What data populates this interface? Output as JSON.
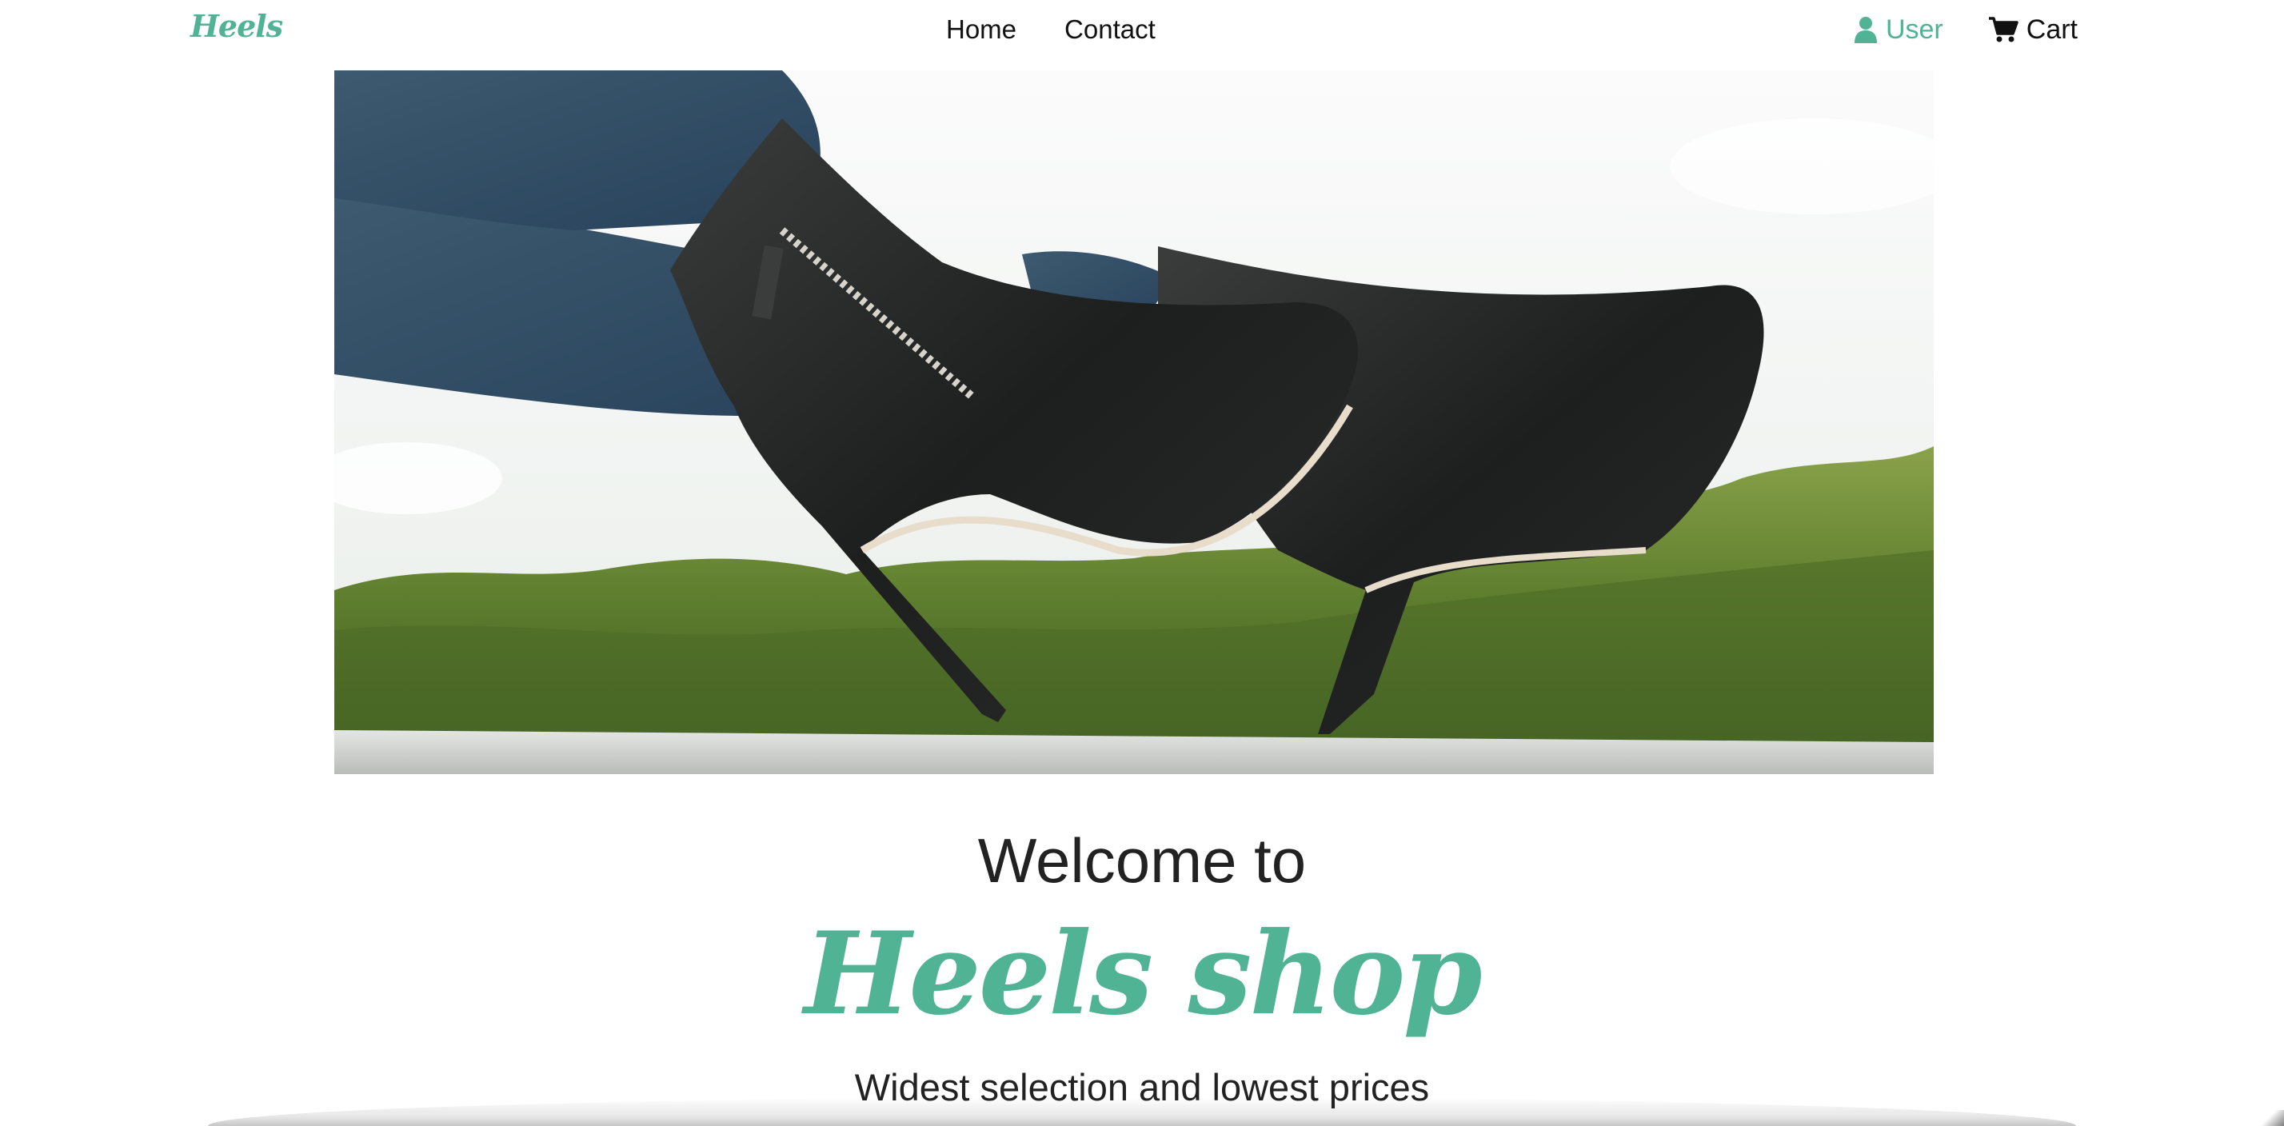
{
  "header": {
    "logo": "Heels",
    "nav": [
      {
        "label": "Home"
      },
      {
        "label": "Contact"
      }
    ],
    "user_label": "User",
    "cart_label": "Cart"
  },
  "hero": {
    "image_icon": "high-heel-boots-photo"
  },
  "main": {
    "welcome": "Welcome to",
    "brand": "Heels shop",
    "tagline": "Widest selection and lowest prices"
  },
  "colors": {
    "accent": "#4fb394",
    "text": "#222222"
  }
}
